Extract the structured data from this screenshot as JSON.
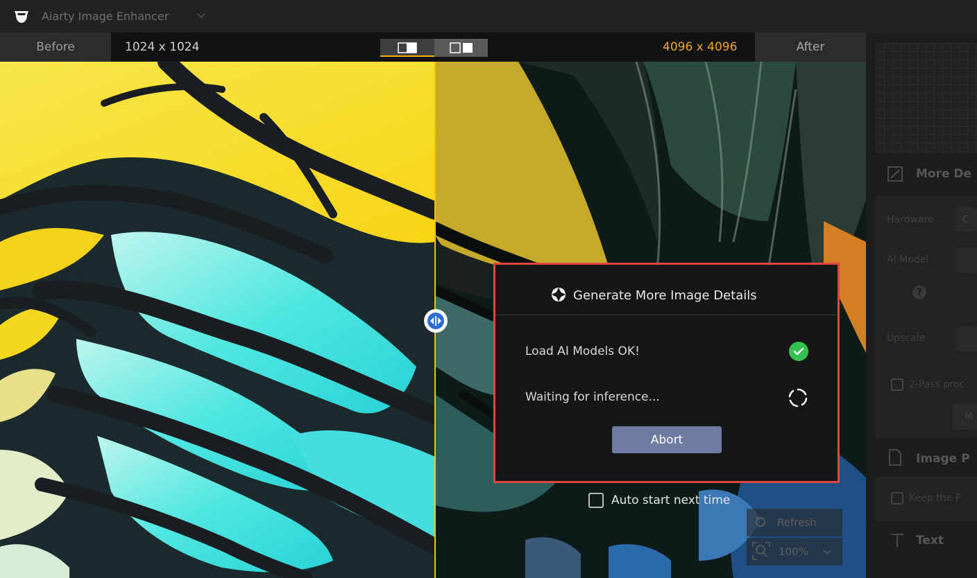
{
  "app": {
    "title": "Aiarty Image Enhancer"
  },
  "compare": {
    "before_label": "Before",
    "before_dims": "1024 x 1024",
    "after_dims": "4096 x 4096",
    "after_label": "After",
    "accent_color": "#f0a623"
  },
  "dialog": {
    "title": "Generate More Image Details",
    "steps": [
      {
        "label": "Load AI Models OK!",
        "status": "done"
      },
      {
        "label": "Waiting for inference...",
        "status": "loading"
      }
    ],
    "abort_label": "Abort",
    "border_color": "#e0463f"
  },
  "auto_start": {
    "label": "Auto start next time",
    "checked": false
  },
  "canvas_tools": {
    "refresh_label": "Refresh",
    "zoom_value": "100%"
  },
  "right_panel": {
    "section1_title": "More De",
    "hardware_label": "Hardware",
    "hardware_value": "C",
    "ai_model_label": "AI Model",
    "upscale_label": "Upscale",
    "two_pass_label": "2-Pass proc",
    "two_pass_button": "M",
    "section2_title": "Image P",
    "keep_label": "Keep the P",
    "section3_title": "Text"
  }
}
